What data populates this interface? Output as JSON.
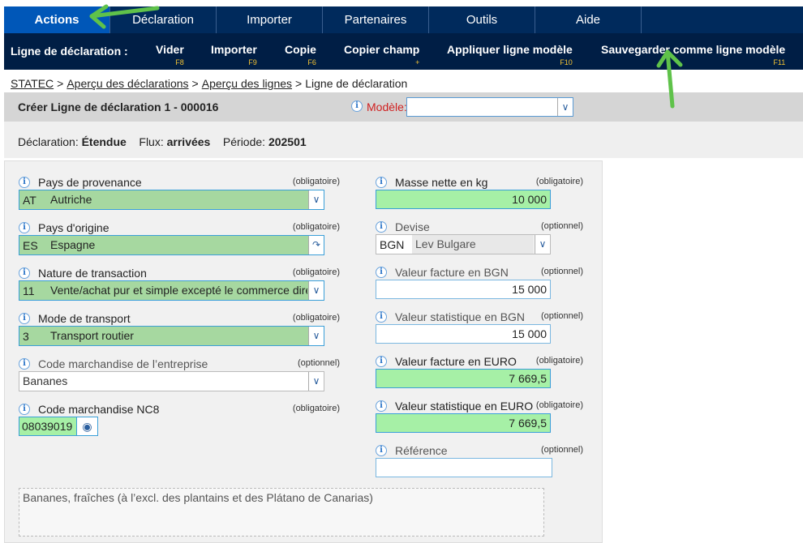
{
  "nav": {
    "tabs": [
      "Actions",
      "Déclaration",
      "Importer",
      "Partenaires",
      "Outils",
      "Aide"
    ]
  },
  "actionbar": {
    "label": "Ligne de déclaration :",
    "actions": [
      {
        "label": "Vider",
        "key": "F8"
      },
      {
        "label": "Importer",
        "key": "F9"
      },
      {
        "label": "Copie",
        "key": "F6"
      },
      {
        "label": "Copier champ",
        "key": "+"
      },
      {
        "label": "Appliquer ligne modèle",
        "key": "F10"
      },
      {
        "label": "Sauvegarder comme ligne modèle",
        "key": "F11"
      }
    ]
  },
  "breadcrumb": {
    "items": [
      "STATEC",
      "Aperçu des déclarations",
      "Aperçu des lignes"
    ],
    "current": "Ligne de déclaration",
    "sep": ">"
  },
  "header": {
    "title": "Créer Ligne de déclaration 1 - 000016",
    "modele_label": "Modèle:"
  },
  "meta": {
    "declaration_label": "Déclaration:",
    "declaration_value": "Étendue",
    "flux_label": "Flux:",
    "flux_value": "arrivées",
    "periode_label": "Période:",
    "periode_value": "202501"
  },
  "form": {
    "pays_provenance": {
      "label": "Pays de provenance",
      "req": "(obligatoire)",
      "code": "AT",
      "value": "Autriche"
    },
    "pays_origine": {
      "label": "Pays d'origine",
      "req": "(obligatoire)",
      "code": "ES",
      "value": "Espagne"
    },
    "nature_transaction": {
      "label": "Nature de transaction",
      "req": "(obligatoire)",
      "code": "11",
      "value": "Vente/achat pur et simple excepté le commerce direct"
    },
    "mode_transport": {
      "label": "Mode de transport",
      "req": "(obligatoire)",
      "code": "3",
      "value": "Transport routier"
    },
    "code_entreprise": {
      "label": "Code marchandise de l’entreprise",
      "req": "(optionnel)",
      "value": "Bananes"
    },
    "code_nc8": {
      "label": "Code marchandise NC8",
      "req": "(obligatoire)",
      "value": "08039019"
    },
    "masse_nette": {
      "label": "Masse nette en kg",
      "req": "(obligatoire)",
      "value": "10 000"
    },
    "devise": {
      "label": "Devise",
      "req": "(optionnel)",
      "code": "BGN",
      "value": "Lev Bulgare"
    },
    "valeur_facture_bgn": {
      "label": "Valeur facture en BGN",
      "req": "(optionnel)",
      "value": "15 000"
    },
    "valeur_stat_bgn": {
      "label": "Valeur statistique en BGN",
      "req": "(optionnel)",
      "value": "15 000"
    },
    "valeur_facture_euro": {
      "label": "Valeur facture en EURO",
      "req": "(obligatoire)",
      "value": "7 669,5"
    },
    "valeur_stat_euro": {
      "label": "Valeur statistique en EURO",
      "req": "(obligatoire)",
      "value": "7 669,5"
    },
    "reference": {
      "label": "Référence",
      "req": "(optionnel)",
      "value": ""
    },
    "description": "Bananes, fraîches (à l’excl. des plantains et des Plátano de Canarias)"
  },
  "colors": {
    "nav": "#002a5c",
    "active_tab": "#0057b8",
    "valid_field": "#a6d8a0",
    "annotation": "#5fc24a"
  }
}
